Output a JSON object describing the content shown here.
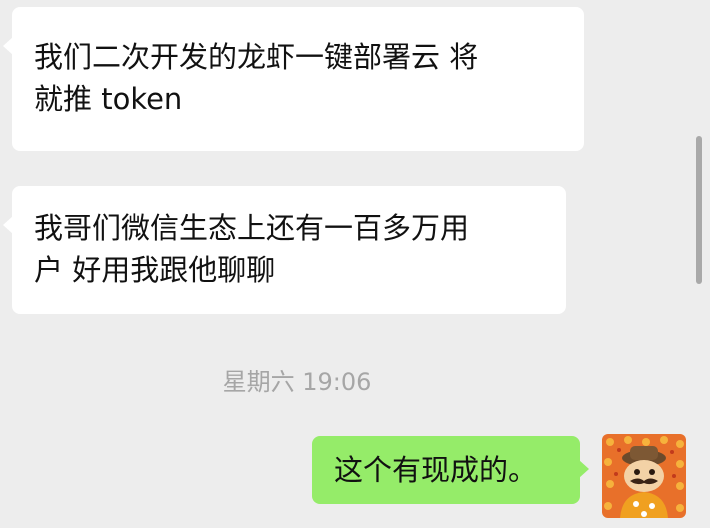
{
  "chat": {
    "messages": [
      {
        "direction": "incoming",
        "lines": [
          "我们二次开发的龙虾一键部署云  将",
          "就推 token"
        ]
      },
      {
        "direction": "incoming",
        "lines": [
          "我哥们微信生态上还有一百多万用",
          "户  好用我跟他聊聊"
        ]
      },
      {
        "direction": "outgoing",
        "text": "这个有现成的。"
      }
    ],
    "timestamp": "星期六 19:06"
  },
  "avatar": {
    "icon": "cartoon-character-avatar-icon"
  },
  "colors": {
    "background": "#ededed",
    "incoming_bubble": "#ffffff",
    "outgoing_bubble": "#95ec69",
    "timestamp_text": "#a6a6a6"
  }
}
